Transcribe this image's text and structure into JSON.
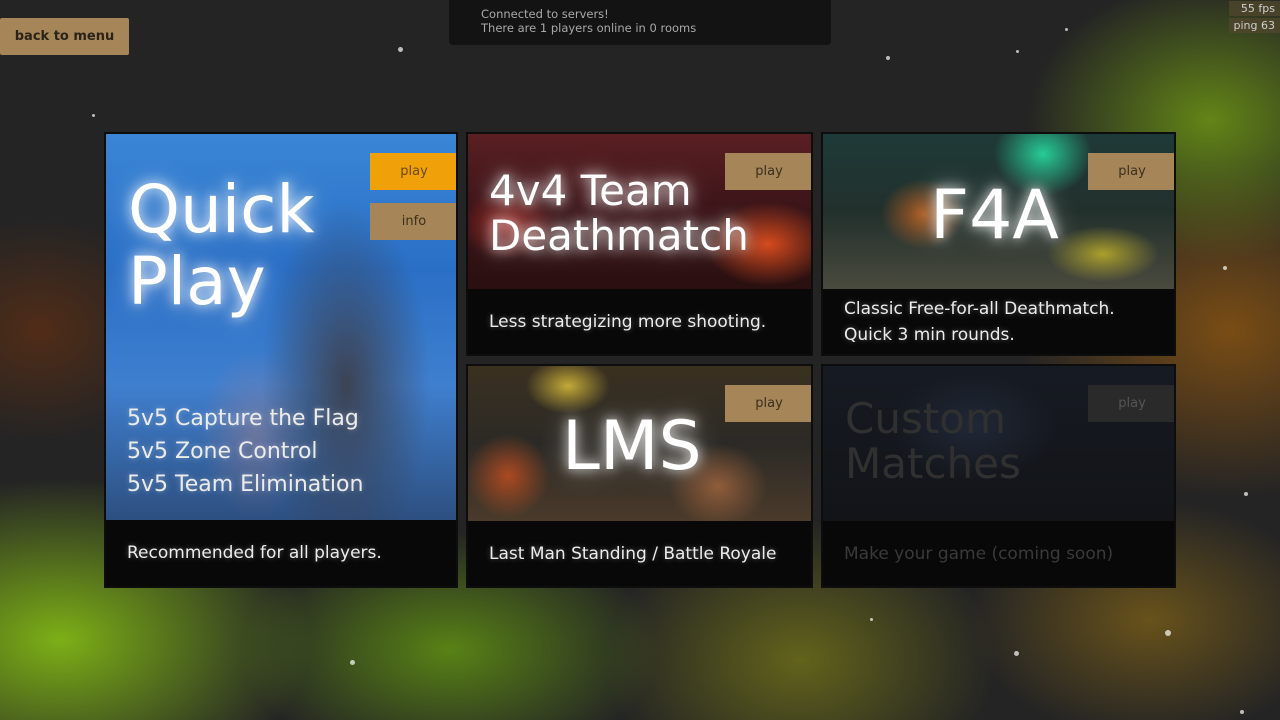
{
  "header": {
    "back_label": "back to menu",
    "status_line1": "Connected to servers!",
    "status_line2": "There are 1 players online in 0 rooms",
    "fps": "55 fps",
    "ping": "ping 63"
  },
  "modes": {
    "quickplay": {
      "title_line1": "Quick",
      "title_line2": "Play",
      "play_label": "play",
      "info_label": "info",
      "modes": [
        "5v5 Capture the Flag",
        "5v5 Zone Control",
        "5v5 Team Elimination"
      ],
      "description": "Recommended for all players."
    },
    "tdm": {
      "title_line1": "4v4 Team",
      "title_line2": "Deathmatch",
      "play_label": "play",
      "description": "Less strategizing more shooting."
    },
    "f4a": {
      "title": "F4A",
      "play_label": "play",
      "description_line1": "Classic Free-for-all Deathmatch.",
      "description_line2": "Quick 3 min rounds."
    },
    "lms": {
      "title": "LMS",
      "play_label": "play",
      "description": "Last Man Standing / Battle Royale"
    },
    "custom": {
      "title_line1": "Custom",
      "title_line2": "Matches",
      "play_label": "play",
      "description": "Make your game (coming soon)"
    }
  },
  "colors": {
    "button": "#a68658",
    "button_active": "#f0a10a",
    "background": "#242424"
  }
}
